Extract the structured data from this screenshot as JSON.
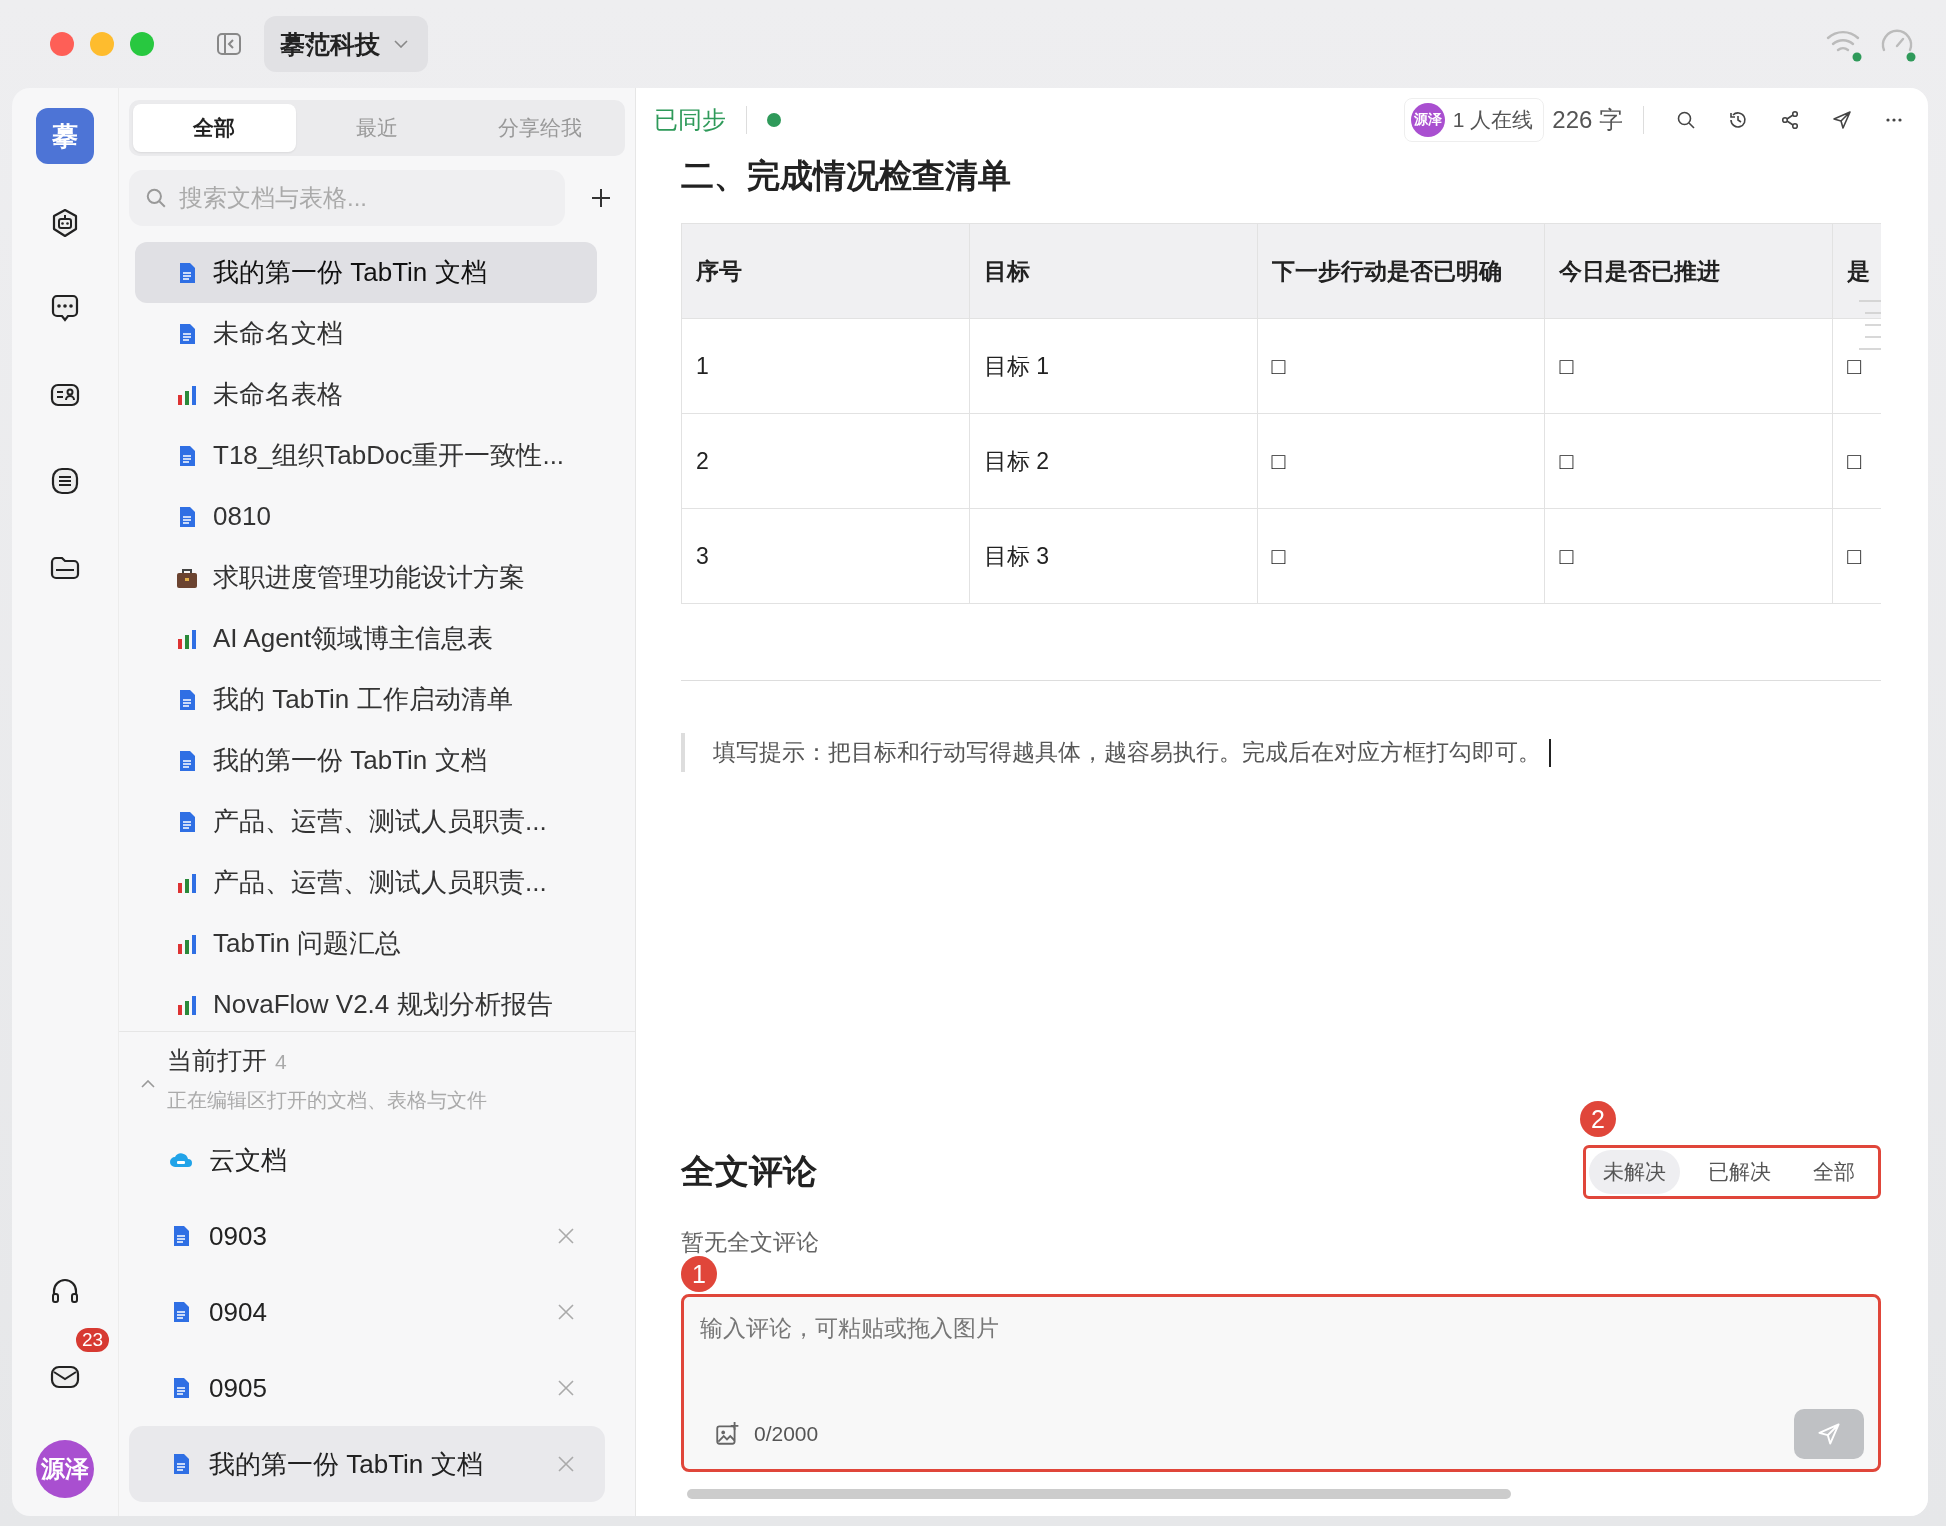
{
  "window": {
    "workspace": "摹范科技"
  },
  "rail": {
    "logo": "摹",
    "mail_badge": "23",
    "avatar": "源泽"
  },
  "sidebar": {
    "tabs": [
      {
        "label": "全部",
        "selected": true
      },
      {
        "label": "最近",
        "selected": false
      },
      {
        "label": "分享给我",
        "selected": false
      }
    ],
    "search": {
      "placeholder": "搜索文档与表格..."
    },
    "documents": [
      {
        "title": "我的第一份 TabTin 文档",
        "kind": "doc",
        "selected": true
      },
      {
        "title": "未命名文档",
        "kind": "doc",
        "selected": false
      },
      {
        "title": "未命名表格",
        "kind": "sheet",
        "selected": false
      },
      {
        "title": "T18_组织TabDoc重开一致性...",
        "kind": "doc",
        "selected": false
      },
      {
        "title": "0810",
        "kind": "doc",
        "selected": false
      },
      {
        "title": "求职进度管理功能设计方案",
        "kind": "case",
        "selected": false
      },
      {
        "title": "AI Agent领域博主信息表",
        "kind": "sheet",
        "selected": false
      },
      {
        "title": "我的 TabTin 工作启动清单",
        "kind": "doc",
        "selected": false
      },
      {
        "title": "我的第一份 TabTin 文档",
        "kind": "doc",
        "selected": false
      },
      {
        "title": "产品、运营、测试人员职责...",
        "kind": "doc",
        "selected": false
      },
      {
        "title": "产品、运营、测试人员职责...",
        "kind": "sheet",
        "selected": false
      },
      {
        "title": "TabTin 问题汇总",
        "kind": "sheet",
        "selected": false
      },
      {
        "title": "NovaFlow V2.4 规划分析报告",
        "kind": "sheet",
        "selected": false
      }
    ],
    "open_section": {
      "title": "当前打开",
      "count": "4",
      "subtitle": "正在编辑区打开的文档、表格与文件",
      "expanded": true,
      "items": [
        {
          "title": "云文档",
          "kind": "cloud",
          "closable": false,
          "selected": false
        },
        {
          "title": "0903",
          "kind": "doc",
          "closable": true,
          "selected": false
        },
        {
          "title": "0904",
          "kind": "doc",
          "closable": true,
          "selected": false
        },
        {
          "title": "0905",
          "kind": "doc",
          "closable": true,
          "selected": false
        },
        {
          "title": "我的第一份 TabTin 文档",
          "kind": "doc",
          "closable": true,
          "selected": true
        }
      ]
    }
  },
  "editor": {
    "sync_status": "已同步",
    "online_avatar": "源泽",
    "online": "1 人在线",
    "word_count": "226 字",
    "heading": "二、完成情况检查清单",
    "table": {
      "columns": [
        "序号",
        "目标",
        "下一步行动是否已明确",
        "今日是否已推进",
        "是"
      ],
      "rows": [
        [
          "1",
          "目标 1",
          "□",
          "□",
          "□"
        ],
        [
          "2",
          "目标 2",
          "□",
          "□",
          "□"
        ],
        [
          "3",
          "目标 3",
          "□",
          "□",
          "□"
        ]
      ]
    },
    "quote": "填写提示：把目标和行动写得越具体，越容易执行。完成后在对应方框打勾即可。",
    "comments": {
      "title": "全文评论",
      "filters": [
        {
          "label": "未解决",
          "selected": true
        },
        {
          "label": "已解决",
          "selected": false
        },
        {
          "label": "全部",
          "selected": false
        }
      ],
      "filters_annotation": {
        "label": "2"
      },
      "empty": "暂无全文评论",
      "input": {
        "placeholder": "输入评论，可粘贴或拖入图片",
        "counter": "0/2000",
        "annotation": {
          "label": "1"
        }
      }
    }
  }
}
